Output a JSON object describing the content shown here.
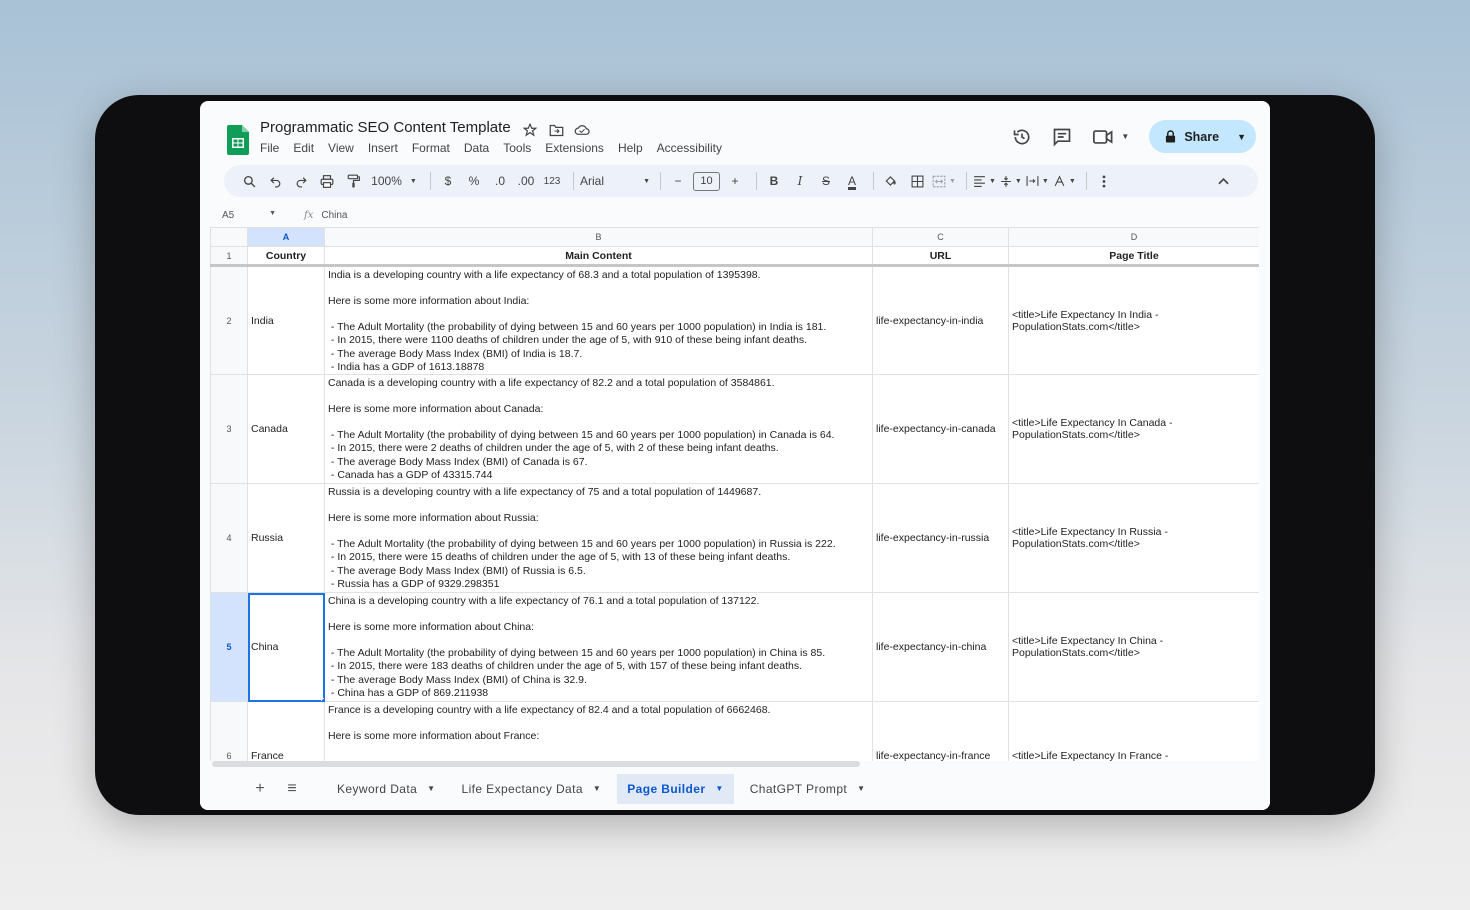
{
  "app": {
    "title": "Programmatic SEO Content Template",
    "menu": [
      "File",
      "Edit",
      "View",
      "Insert",
      "Format",
      "Data",
      "Tools",
      "Extensions",
      "Help",
      "Accessibility"
    ],
    "share_label": "Share"
  },
  "toolbar": {
    "zoom": "100%",
    "currency": "$",
    "percent": "%",
    "decrease_decimal": ".0",
    "increase_decimal": ".00",
    "number_format": "123",
    "font": "Arial",
    "font_size": "10",
    "minus": "−",
    "plus": "+",
    "bold": "B",
    "italic": "I",
    "strike": "S",
    "text_color": "A"
  },
  "formula_bar": {
    "name_box": "A5",
    "fx": "fx",
    "value": "China"
  },
  "columns": [
    "A",
    "B",
    "C",
    "D"
  ],
  "header_row": {
    "number": "1",
    "cells": [
      "Country",
      "Main Content",
      "URL",
      "Page Title"
    ]
  },
  "rows": [
    {
      "number": "2",
      "country": "India",
      "content": "India is a developing country with a life expectancy of 68.3 and a total population of 1395398.\n\nHere is some more information about India:\n\n - The Adult Mortality (the probability of dying between 15 and 60 years per 1000 population) in India is 181.\n - In 2015, there were 1100 deaths of children under the age of 5, with 910 of these being infant deaths.\n - The average Body Mass Index (BMI) of India is 18.7.\n - India has a GDP of 1613.18878",
      "url": "life-expectancy-in-india",
      "title": "<title>Life Expectancy In India - PopulationStats.com</title>"
    },
    {
      "number": "3",
      "country": "Canada",
      "content": "Canada is a developing country with a life expectancy of 82.2 and a total population of 3584861.\n\nHere is some more information about Canada:\n\n - The Adult Mortality (the probability of dying between 15 and 60 years per 1000 population) in Canada is 64.\n - In 2015, there were 2 deaths of children under the age of 5, with 2 of these being infant deaths.\n - The average Body Mass Index (BMI) of Canada is 67.\n - Canada has a GDP of 43315.744",
      "url": "life-expectancy-in-canada",
      "title": "<title>Life Expectancy In Canada - PopulationStats.com</title>"
    },
    {
      "number": "4",
      "country": "Russia",
      "content": "Russia is a developing country with a life expectancy of 75 and a total population of 1449687.\n\nHere is some more information about Russia:\n\n - The Adult Mortality (the probability of dying between 15 and 60 years per 1000 population) in Russia is 222.\n - In 2015, there were 15 deaths of children under the age of 5, with 13 of these being infant deaths.\n - The average Body Mass Index (BMI) of Russia is 6.5.\n - Russia has a GDP of 9329.298351",
      "url": "life-expectancy-in-russia",
      "title": "<title>Life Expectancy In Russia - PopulationStats.com</title>"
    },
    {
      "number": "5",
      "country": "China",
      "content": "China is a developing country with a life expectancy of 76.1 and a total population of 137122.\n\nHere is some more information about China:\n\n - The Adult Mortality (the probability of dying between 15 and 60 years per 1000 population) in China is 85.\n - In 2015, there were 183 deaths of children under the age of 5, with 157 of these being infant deaths.\n - The average Body Mass Index (BMI) of China is 32.9.\n - China has a GDP of 869.211938",
      "url": "life-expectancy-in-china",
      "title": "<title>Life Expectancy In China - PopulationStats.com</title>"
    },
    {
      "number": "6",
      "country": "France",
      "content": "France is a developing country with a life expectancy of 82.4 and a total population of 6662468.\n\nHere is some more information about France:",
      "url": "life-expectancy-in-france",
      "title": "<title>Life Expectancy In France -"
    }
  ],
  "sheet_tabs": [
    "Keyword Data",
    "Life Expectancy Data",
    "Page Builder",
    "ChatGPT Prompt"
  ],
  "active_tab": "Page Builder",
  "colors": {
    "accent": "#0b57d0",
    "selection": "#d3e3fd",
    "share_bg": "#c2e7ff",
    "sheets_green": "#0f9d58"
  }
}
